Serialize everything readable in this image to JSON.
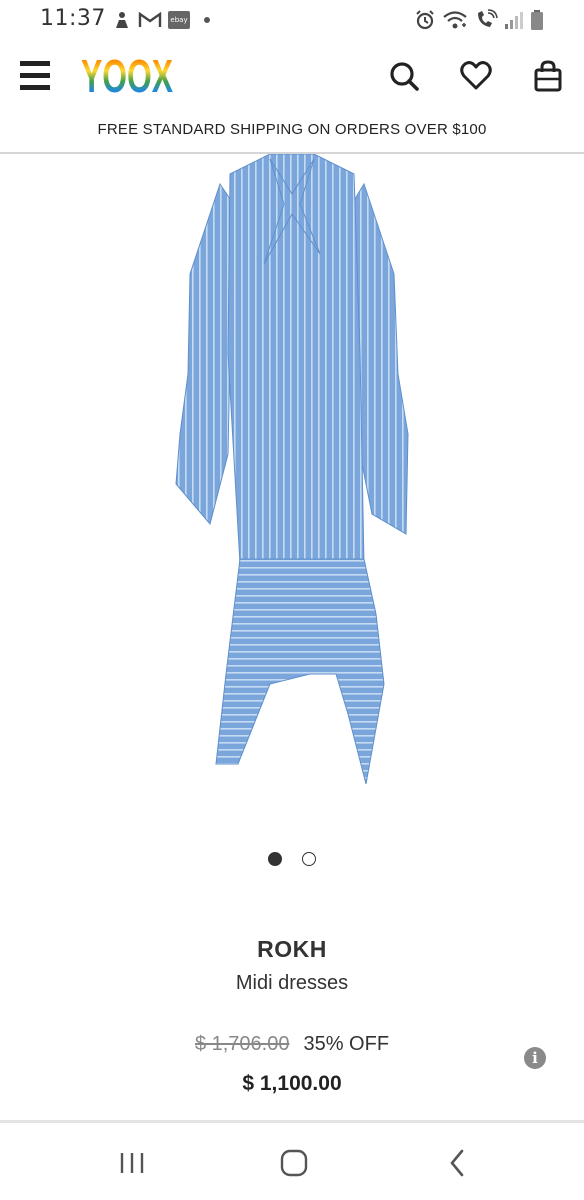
{
  "status_bar": {
    "time": "11:37",
    "ebay_badge": "ebay",
    "left_icons": [
      "person-notification-icon",
      "gmail-icon",
      "ebay-icon"
    ],
    "right_icons": [
      "alarm-icon",
      "wifi-icon",
      "wifi-calling-icon",
      "signal-icon",
      "battery-icon"
    ]
  },
  "header": {
    "logo_text": "YOOX",
    "logo_colors": [
      "#e53935",
      "#fb8c00",
      "#fdd835",
      "#43a047",
      "#1e88e5",
      "#8e24aa"
    ],
    "icons": [
      "menu-icon",
      "search-icon",
      "heart-icon",
      "shopping-bag-icon"
    ]
  },
  "shipping_banner": "FREE STANDARD SHIPPING ON ORDERS OVER $100",
  "carousel": {
    "total": 2,
    "active_index": 0
  },
  "product": {
    "image_color": "#7aa6dc",
    "brand": "ROKH",
    "category": "Midi dresses",
    "original_price": "$ 1,706.00",
    "discount": "35% OFF",
    "price": "$ 1,100.00",
    "info_icon": "i"
  },
  "nav_bar": {
    "icons": [
      "recent-apps-icon",
      "home-icon",
      "back-icon"
    ]
  }
}
